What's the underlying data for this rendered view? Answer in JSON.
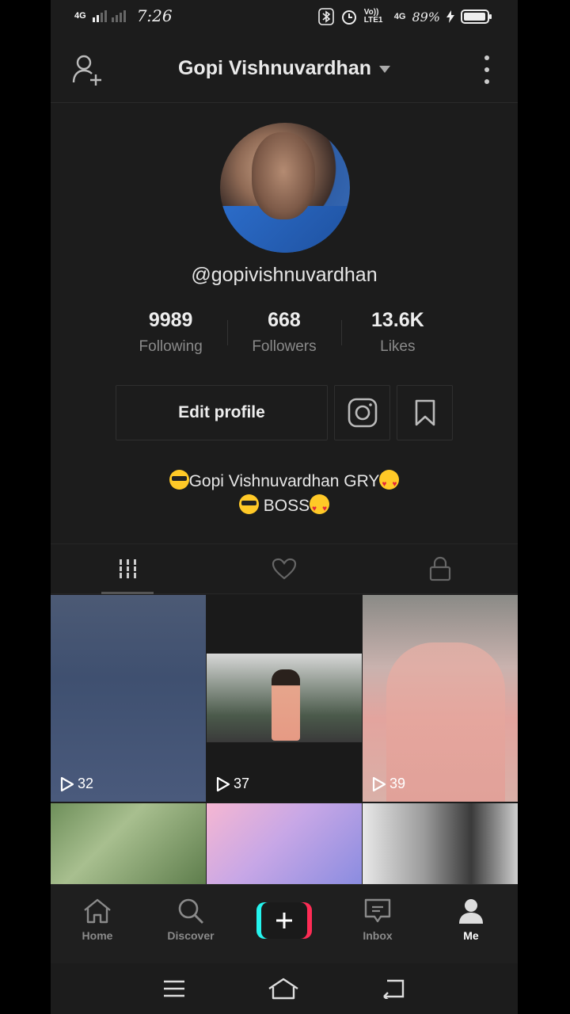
{
  "status_bar": {
    "network_label": "4G",
    "time": "7:26",
    "volte_label": "Vo)) LTE1",
    "network2_label": "4G",
    "battery": "89%"
  },
  "header": {
    "title": "Gopi Vishnuvardhan"
  },
  "profile": {
    "username": "@gopivishnuvardhan",
    "stats": [
      {
        "value": "9989",
        "label": "Following"
      },
      {
        "value": "668",
        "label": "Followers"
      },
      {
        "value": "13.6K",
        "label": "Likes"
      }
    ],
    "edit_label": "Edit profile",
    "bio_line1": "Gopi Vishnuvardhan  GRY",
    "bio_line2": " BOSS"
  },
  "videos": [
    {
      "views": "32"
    },
    {
      "views": "37"
    },
    {
      "views": "39"
    }
  ],
  "bottom_nav": {
    "home": "Home",
    "discover": "Discover",
    "inbox": "Inbox",
    "me": "Me"
  },
  "colors": {
    "background": "#1c1c1c",
    "accent_cyan": "#25f4ee",
    "accent_red": "#fe2c55"
  }
}
